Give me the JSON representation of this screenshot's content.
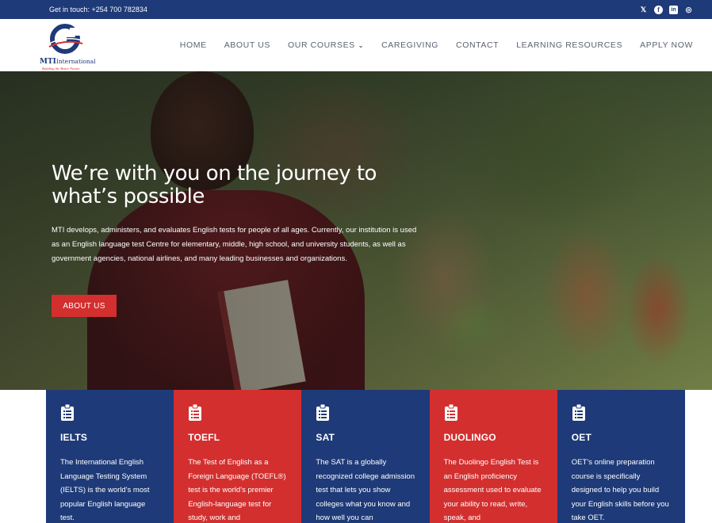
{
  "topbar": {
    "contact": "Get in touch: +254 700 782834",
    "social": [
      {
        "name": "twitter-icon",
        "glyph": "𝕏"
      },
      {
        "name": "facebook-icon",
        "glyph": "f"
      },
      {
        "name": "linkedin-icon",
        "glyph": "in"
      },
      {
        "name": "tripadvisor-icon",
        "glyph": "◎"
      }
    ]
  },
  "logo": {
    "brand_main": "MTI",
    "brand_rest": "International",
    "tagline": "Building the Better Future"
  },
  "nav": {
    "items": [
      "HOME",
      "ABOUT US",
      "OUR COURSES",
      "CAREGIVING",
      "CONTACT",
      "LEARNING RESOURCES",
      "APPLY NOW"
    ]
  },
  "hero": {
    "title": "We’re with you on the journey to what’s possible",
    "description": "MTI develops, administers, and evaluates  English tests for people of all ages. Currently, our institution is used as an  English language test Centre for elementary, middle, high school, and university students, as well as government agencies, national airlines, and many leading businesses and organizations.",
    "button": "ABOUT US"
  },
  "courses": [
    {
      "title": "IELTS",
      "text": "The International English Language Testing System (IELTS) is the world's most popular English language test.",
      "color": "blue"
    },
    {
      "title": "TOEFL",
      "text": "The Test of English as a Foreign Language (TOEFL®) test is the world’s premier English-language test for study, work and",
      "color": "red"
    },
    {
      "title": "SAT",
      "text": "The SAT is a globally recognized college admission test that lets you show colleges what you know and how well you can",
      "color": "blue"
    },
    {
      "title": "DUOLINGO",
      "text": "The Duolingo English Test is an English proficiency assessment used to evaluate your ability to read, write, speak, and",
      "color": "red"
    },
    {
      "title": "OET",
      "text": "OET’s online preparation course is specifically designed to help you build your English skills before you take OET.",
      "color": "blue"
    }
  ],
  "colors": {
    "primary_blue": "#1e3a78",
    "accent_red": "#d32f2f"
  }
}
